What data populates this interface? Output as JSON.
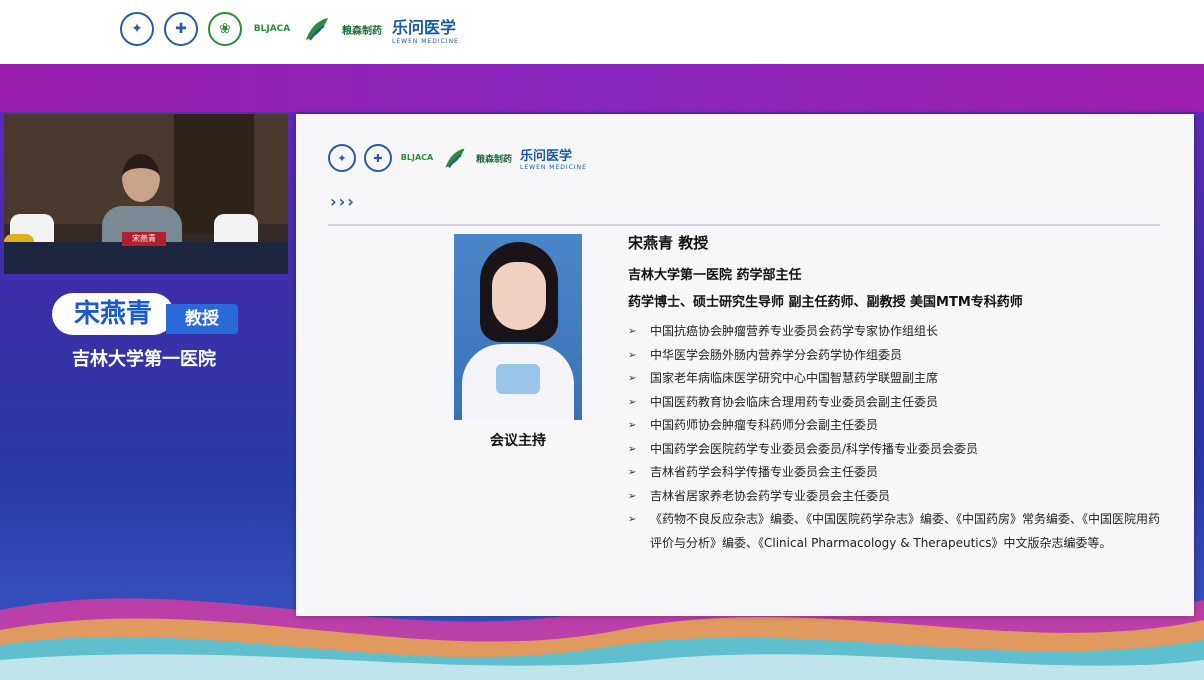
{
  "header": {
    "logos": [
      "university-emblem-icon",
      "hospital-emblem-icon",
      "association-emblem-icon",
      "BLJACA",
      "leaf-logo-icon",
      "粮森制药",
      "乐问医学"
    ],
    "brand_text": "乐问医学",
    "brand_sub": "LEWEN MEDICINE",
    "pharma_text": "粮森制药",
    "assoc_text": "BLJACA"
  },
  "video": {
    "nameplate": "宋燕青"
  },
  "speaker_label": {
    "name": "宋燕青",
    "title": "教授",
    "organization": "吉林大学第一医院"
  },
  "slide": {
    "chevrons": "›››",
    "photo_caption": "会议主持",
    "name_title": "宋燕青 教授",
    "org_position": "吉林大学第一医院  药学部主任",
    "qualifications": "药学博士、硕士研究生导师  副主任药师、副教授  美国MTM专科药师",
    "bullet_glyph": "➢",
    "roles": [
      "中国抗癌协会肿瘤营养专业委员会药学专家协作组组长",
      "中华医学会肠外肠内营养学分会药学协作组委员",
      "国家老年病临床医学研究中心中国智慧药学联盟副主席",
      "中国医药教育协会临床合理用药专业委员会副主任委员",
      "中国药师协会肿瘤专科药师分会副主任委员",
      "中国药学会医院药学专业委员会委员/科学传播专业委员会委员",
      "吉林省药学会科学传播专业委员会主任委员",
      "吉林省居家养老协会药学专业委员会主任委员",
      "《药物不良反应杂志》编委、《中国医院药学杂志》编委、《中国药房》常务编委、《中国医院用药评价与分析》编委、《Clinical Pharmacology & Therapeutics》中文版杂志编委等。"
    ]
  },
  "colors": {
    "accent": "#2a6ad8",
    "band": "#9a1fb0"
  }
}
